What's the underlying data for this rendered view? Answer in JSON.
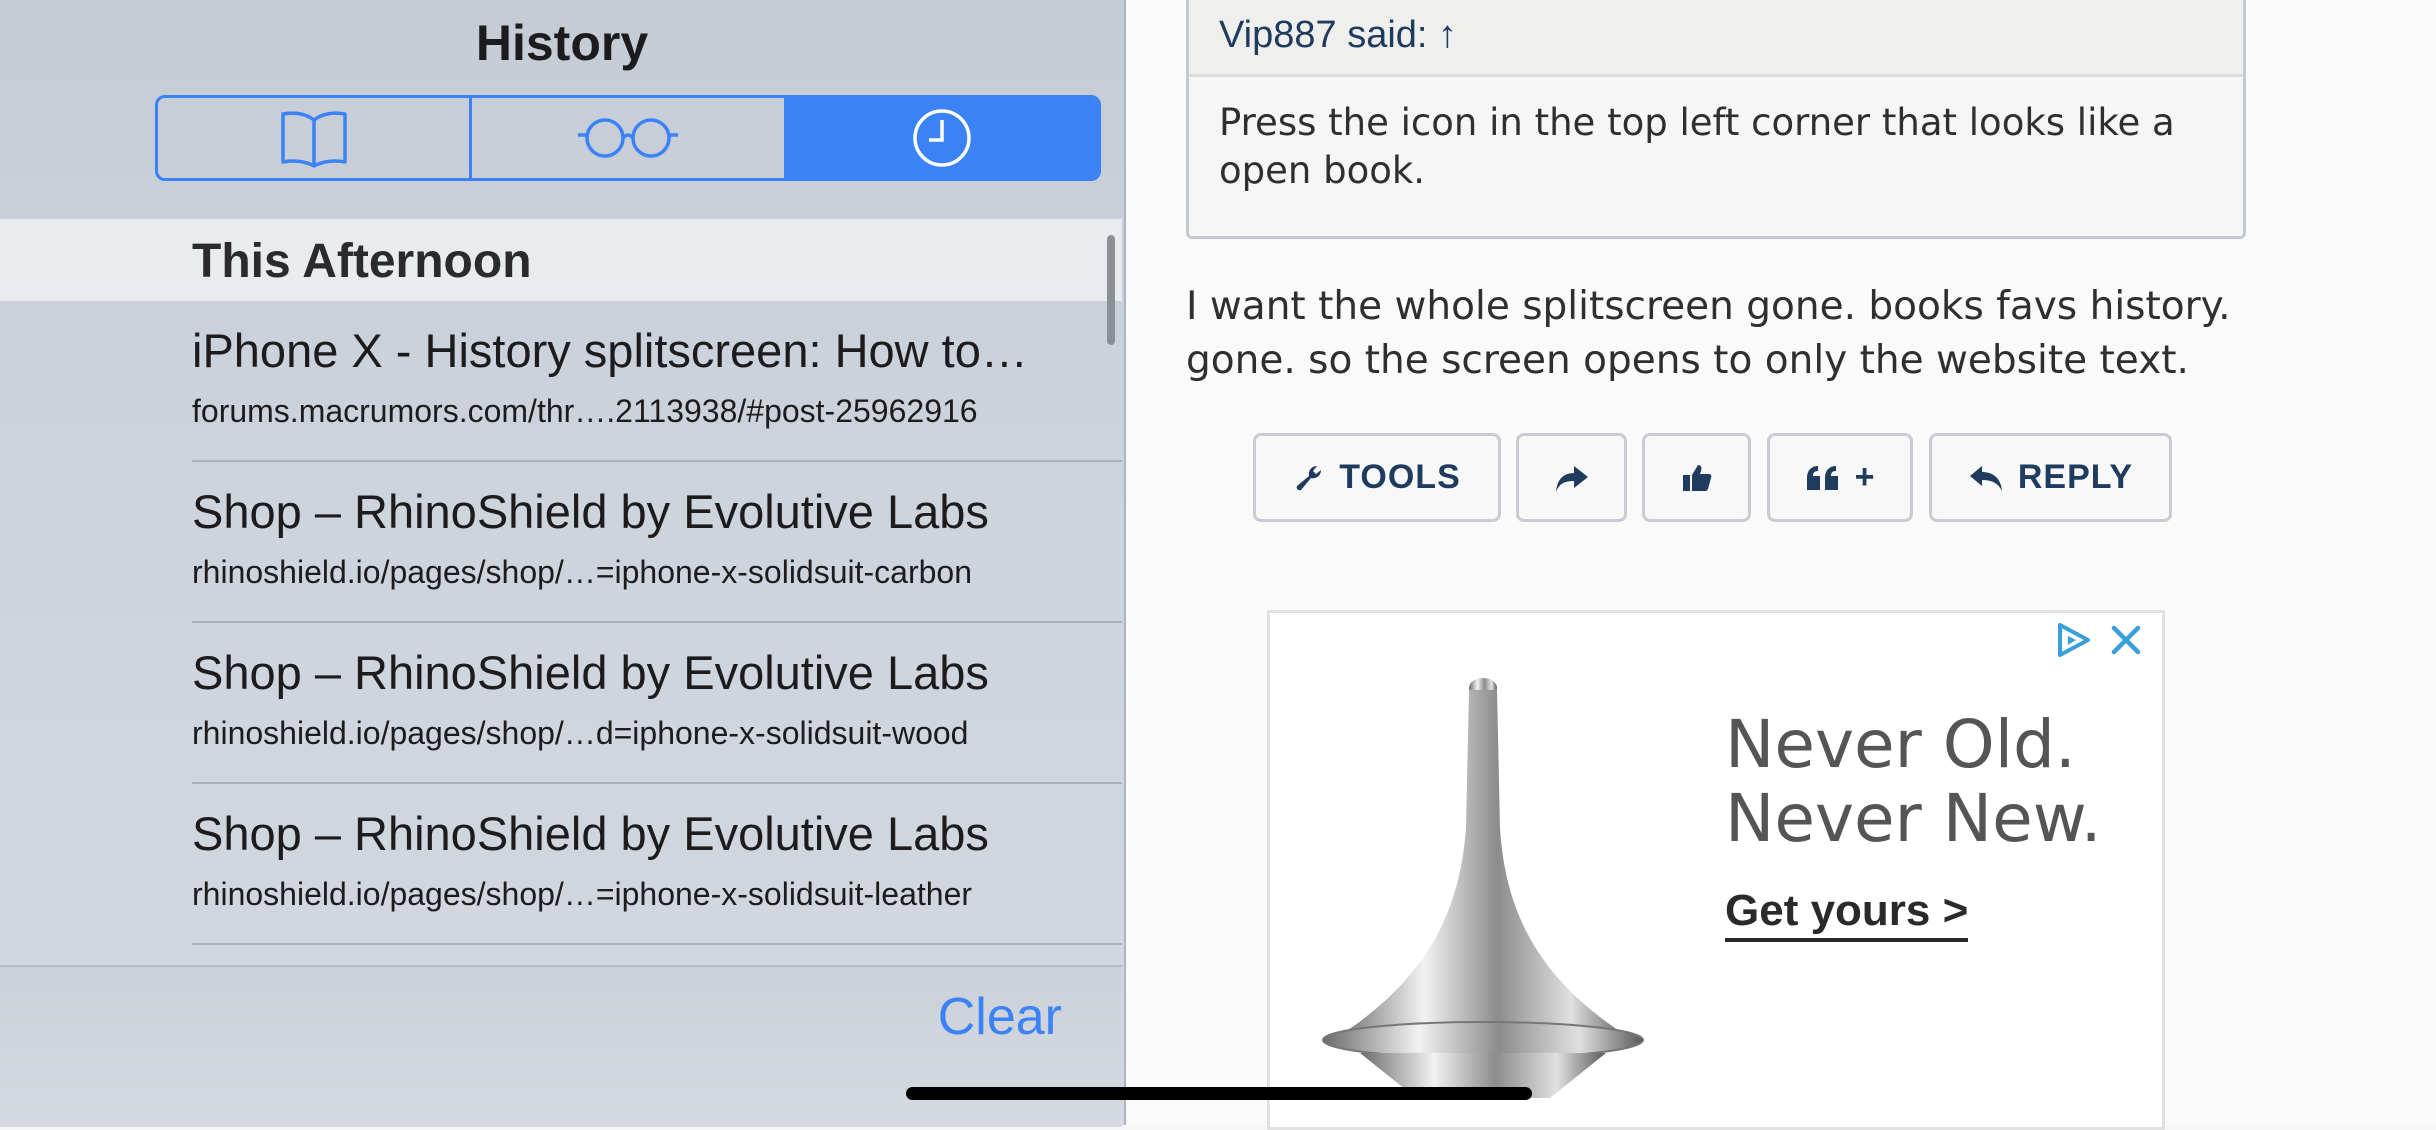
{
  "sidebar": {
    "title": "History",
    "segments": [
      {
        "icon": "bookmarks-book-icon",
        "selected": false
      },
      {
        "icon": "reading-list-glasses-icon",
        "selected": false
      },
      {
        "icon": "history-clock-icon",
        "selected": true
      }
    ],
    "section_header": "This Afternoon",
    "items": [
      {
        "title": "iPhone X - History splitscreen: How to…",
        "url": "forums.macrumors.com/thr….2113938/#post-25962916"
      },
      {
        "title": "Shop – RhinoShield by Evolutive Labs",
        "url": "rhinoshield.io/pages/shop/…=iphone-x-solidsuit-carbon"
      },
      {
        "title": "Shop – RhinoShield by Evolutive Labs",
        "url": "rhinoshield.io/pages/shop/…d=iphone-x-solidsuit-wood"
      },
      {
        "title": "Shop – RhinoShield by Evolutive Labs",
        "url": "rhinoshield.io/pages/shop/…=iphone-x-solidsuit-leather"
      }
    ],
    "clear_label": "Clear"
  },
  "post": {
    "quote_author": "Vip887 said: ↑",
    "quote_text": "Press the icon in the top left corner that looks like a open book.",
    "body": "I want the whole splitscreen gone. books favs history. gone. so the screen opens to only the website text.",
    "actions": {
      "tools": "TOOLS",
      "multiquote": "+",
      "reply": "REPLY"
    }
  },
  "ad": {
    "tagline_line1": "Never Old.",
    "tagline_line2": "Never New.",
    "cta": "Get yours >"
  },
  "colors": {
    "accent": "#3b82f6",
    "forum_text": "#1f3b5d"
  }
}
